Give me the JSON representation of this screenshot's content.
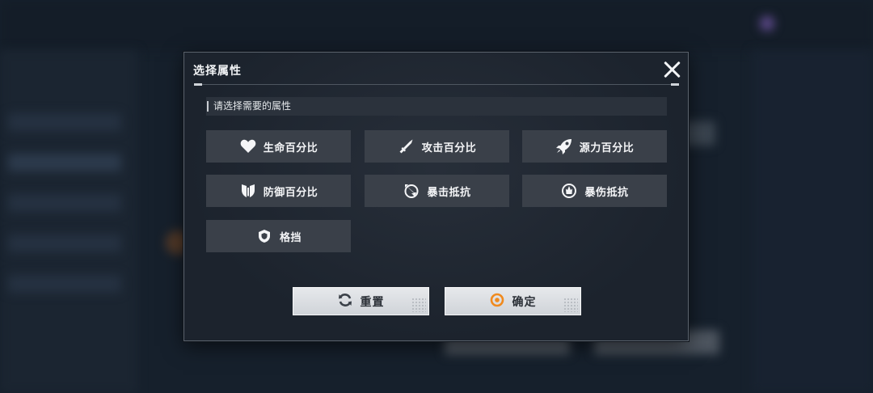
{
  "dialog": {
    "title": "选择属性",
    "subheader": "请选择需要的属性",
    "close_icon": "close-icon"
  },
  "attributes": [
    {
      "label": "生命百分比",
      "icon": "heart-icon"
    },
    {
      "label": "攻击百分比",
      "icon": "sword-icon"
    },
    {
      "label": "源力百分比",
      "icon": "rocket-icon"
    },
    {
      "label": "防御百分比",
      "icon": "shield-emblem-icon"
    },
    {
      "label": "暴击抵抗",
      "icon": "crit-resist-icon"
    },
    {
      "label": "暴伤抵抗",
      "icon": "crit-damage-resist-icon"
    },
    {
      "label": "格挡",
      "icon": "block-shield-icon"
    }
  ],
  "actions": {
    "reset_label": "重置",
    "reset_icon": "refresh-icon",
    "confirm_label": "确定",
    "confirm_icon": "confirm-ring-icon"
  },
  "colors": {
    "accent": "#f08a1e",
    "button_bg": "#3a4049",
    "dialog_bg": "#1c232d"
  }
}
